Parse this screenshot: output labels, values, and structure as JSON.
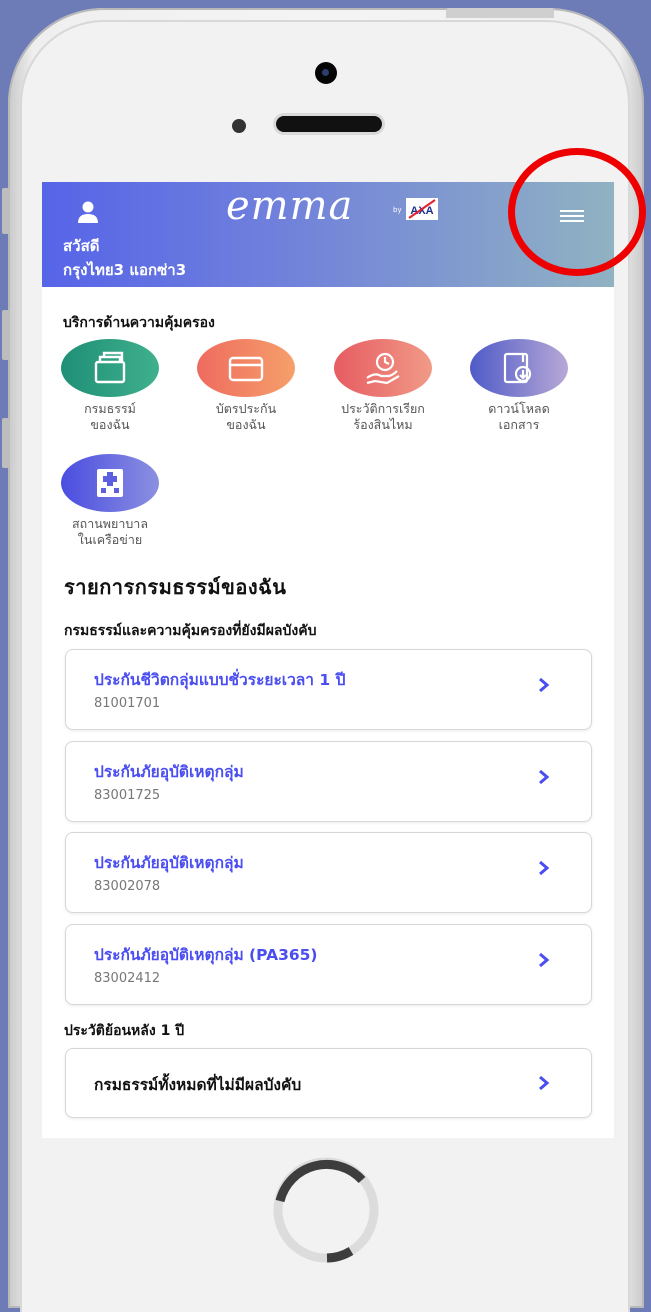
{
  "header": {
    "greeting": "สวัสดี",
    "user_name": "กรุงไทย3 แอกซ่า3",
    "logo_text": "emma",
    "logo_by": "by",
    "logo_brand": "AXA"
  },
  "services": {
    "section_title": "บริการด้านความคุ้มครอง",
    "items": [
      {
        "line1": "กรมธรรม์",
        "line2": "ของฉัน",
        "icon": "policy-documents-icon",
        "color": "#2f9a7c"
      },
      {
        "line1": "บัตรประกัน",
        "line2": "ของฉัน",
        "icon": "insurance-card-icon",
        "color": "#f17f62"
      },
      {
        "line1": "ประวัติการเรียก",
        "line2": "ร้องสินไหม",
        "icon": "claim-history-icon",
        "color": "#ec6f6f"
      },
      {
        "line1": "ดาวน์โหลด",
        "line2": "เอกสาร",
        "icon": "download-document-icon",
        "color": "#5f67c9"
      },
      {
        "line1": "สถานพยาบาล",
        "line2": "ในเครือข่าย",
        "icon": "hospital-icon",
        "color": "#5b5fe0"
      }
    ]
  },
  "policies": {
    "title": "รายการกรมธรรม์ของฉัน",
    "active_heading": "กรมธรรม์และความคุ้มครองที่ยังมีผลบังคับ",
    "items": [
      {
        "name": "ประกันชีวิตกลุ่มแบบชั่วระยะเวลา 1 ปี",
        "number": "81001701"
      },
      {
        "name": "ประกันภัยอุบัติเหตุกลุ่ม",
        "number": "83001725"
      },
      {
        "name": "ประกันภัยอุบัติเหตุกลุ่ม",
        "number": "83002078"
      },
      {
        "name": "ประกันภัยอุบัติเหตุกลุ่ม (PA365)",
        "number": "83002412"
      }
    ],
    "history_heading": "ประวัติย้อนหลัง 1 ปี",
    "inactive_label": "กรมธรรม์ทั้งหมดที่ไม่มีผลบังคับ",
    "chevron": ">"
  },
  "colors": {
    "accent": "#4a4df0",
    "highlight_circle": "#ee0000",
    "background": "#6d7cb6"
  }
}
